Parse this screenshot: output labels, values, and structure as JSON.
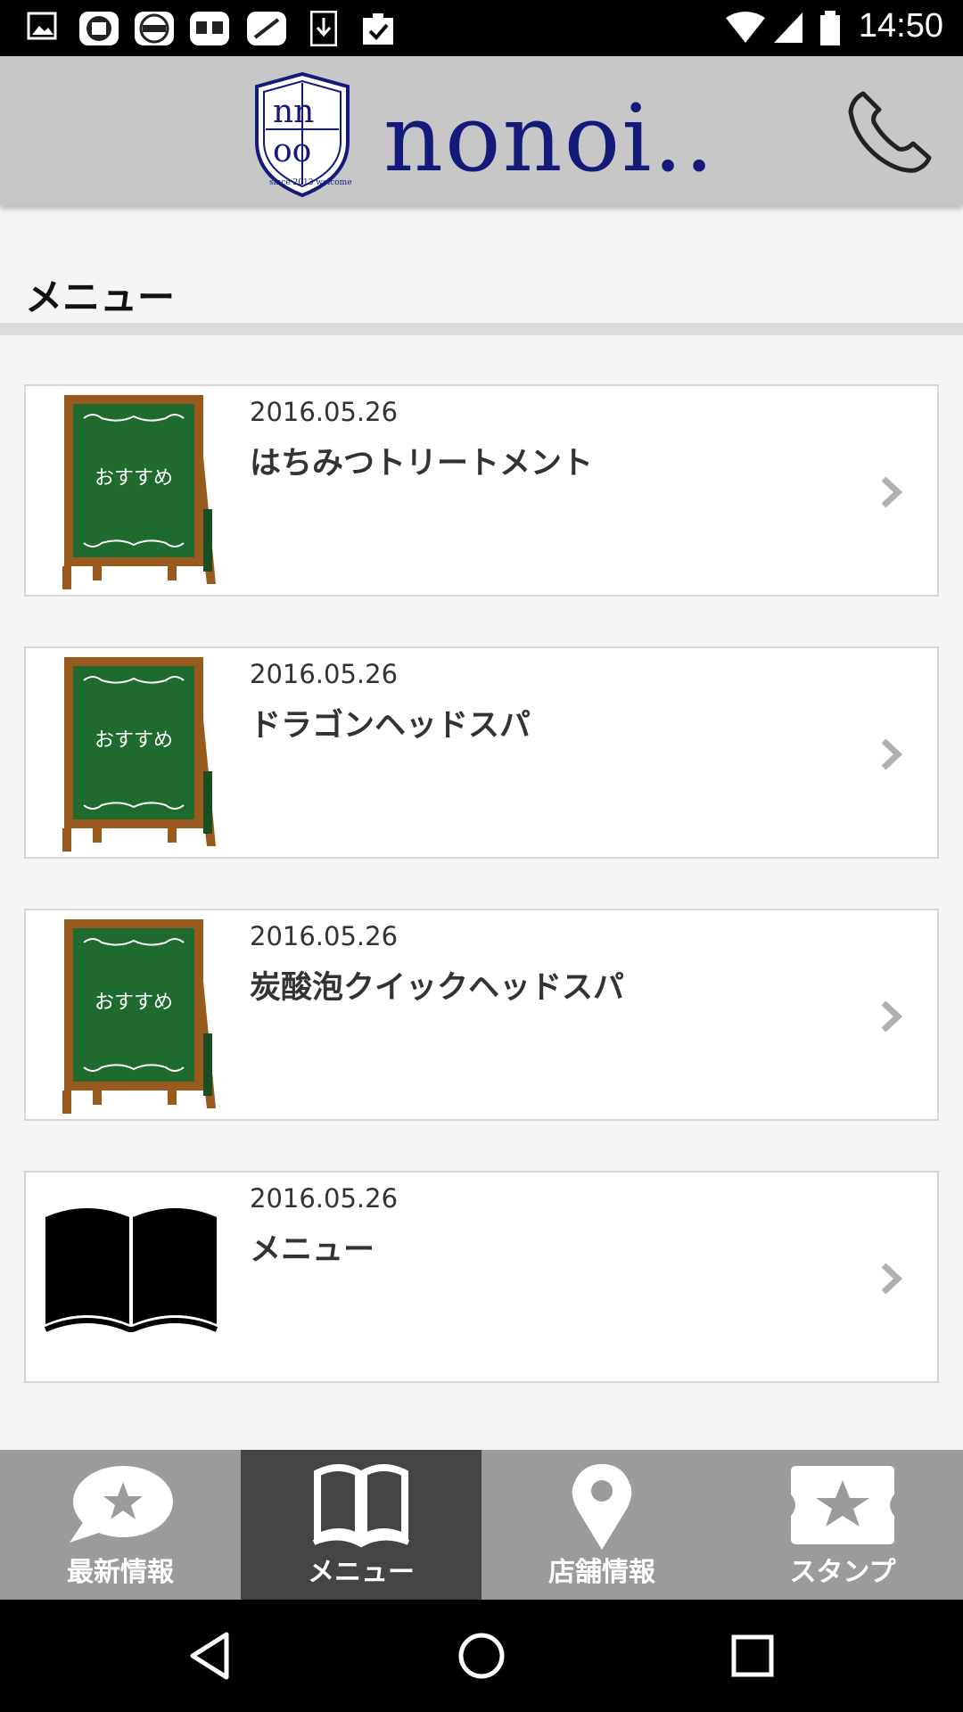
{
  "status_bar": {
    "time": "14:50",
    "notification_icons": [
      "gallery-icon",
      "app-icon-1",
      "app-icon-2",
      "app-icon-3",
      "app-icon-4",
      "download-icon",
      "clipboard-check-icon"
    ],
    "system_icons": [
      "wifi-icon",
      "signal-icon",
      "battery-icon"
    ]
  },
  "header": {
    "logo_text": "nonoi..",
    "emblem_lines": [
      "nn",
      "oo",
      "since 2013 welcome"
    ],
    "phone_icon": "phone-icon"
  },
  "page": {
    "section_title": "メニュー"
  },
  "thumb_text": "おすすめ",
  "items": [
    {
      "date": "2016.05.26",
      "title": "はちみつトリートメント",
      "thumb": "chalkboard"
    },
    {
      "date": "2016.05.26",
      "title": "ドラゴンヘッドスパ",
      "thumb": "chalkboard"
    },
    {
      "date": "2016.05.26",
      "title": "炭酸泡クイックヘッドスパ",
      "thumb": "chalkboard"
    },
    {
      "date": "2016.05.26",
      "title": "メニュー",
      "thumb": "book"
    }
  ],
  "bottom_nav": {
    "tabs": [
      {
        "label": "最新情報",
        "icon": "news-bubble-icon",
        "active": false
      },
      {
        "label": "メニュー",
        "icon": "book-icon",
        "active": true
      },
      {
        "label": "店舗情報",
        "icon": "map-pin-icon",
        "active": false
      },
      {
        "label": "スタンプ",
        "icon": "stamp-star-icon",
        "active": false
      }
    ]
  },
  "system_nav": [
    "back-icon",
    "home-icon",
    "recents-icon"
  ],
  "colors": {
    "header_bg": "#c7c7c7",
    "logo": "#141a7a",
    "nav_bg": "#9b9b9b",
    "nav_active": "#444444",
    "chalkboard": "#1f6b2f",
    "wood": "#9a5a1e"
  }
}
